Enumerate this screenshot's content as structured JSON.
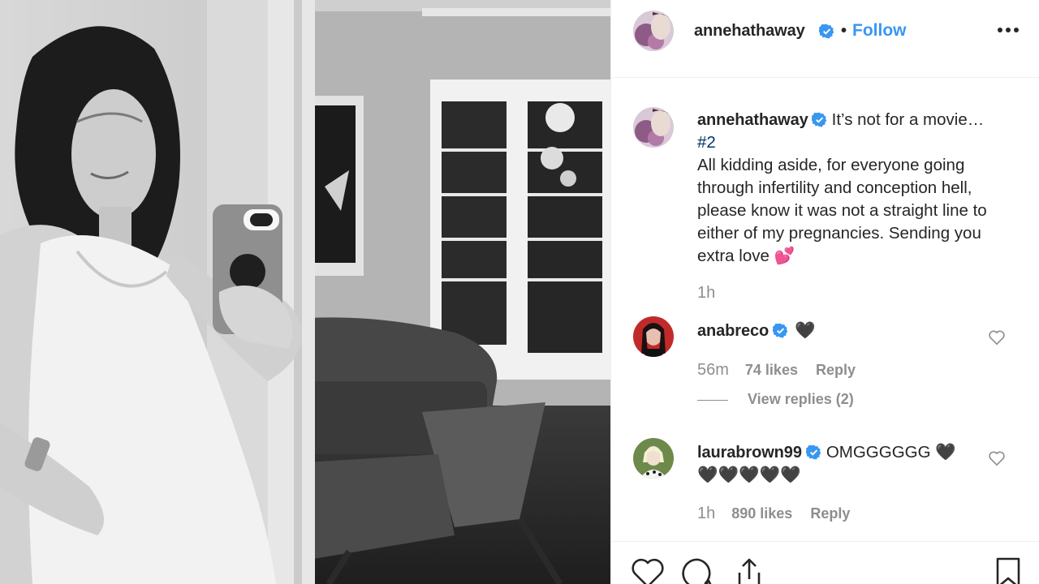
{
  "post": {
    "author": "annehathaway",
    "follow_label": "Follow",
    "separator": "•",
    "caption_text": "It’s not for a movie…",
    "hashtag": "#2",
    "caption_body": "All kidding aside, for everyone going through infertility and conception hell, please know it was not a straight line to either of my pregnancies. Sending you extra love 💕",
    "time": "1h"
  },
  "comments": [
    {
      "username": "anabreco",
      "text": "🖤",
      "time": "56m",
      "likes": "74 likes",
      "reply_label": "Reply",
      "view_replies": "View replies (2)"
    },
    {
      "username": "laurabrown99",
      "text": "OMGGGGGG 🖤",
      "text_line2": "🖤🖤🖤🖤🖤",
      "time": "1h",
      "likes": "890 likes",
      "reply_label": "Reply"
    }
  ],
  "colors": {
    "accent": "#3897f0",
    "hashtag": "#003569",
    "muted": "#8e8e8e",
    "text": "#262626"
  },
  "icons": [
    "verified-badge-icon",
    "more-options-icon",
    "heart-icon",
    "comment-icon",
    "share-icon",
    "bookmark-icon"
  ]
}
